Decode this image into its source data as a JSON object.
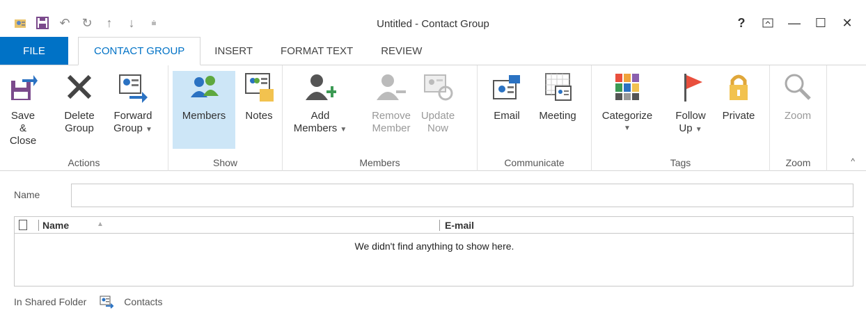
{
  "window": {
    "title": "Untitled - Contact Group",
    "help": "?"
  },
  "tabs": [
    {
      "label": "FILE"
    },
    {
      "label": "CONTACT GROUP"
    },
    {
      "label": "INSERT"
    },
    {
      "label": "FORMAT TEXT"
    },
    {
      "label": "REVIEW"
    }
  ],
  "ribbon": {
    "actions": {
      "label": "Actions",
      "save_close": {
        "line1": "Save &",
        "line2": "Close"
      },
      "delete_group": {
        "line1": "Delete",
        "line2": "Group"
      },
      "forward_group": {
        "line1": "Forward",
        "line2": "Group"
      }
    },
    "show": {
      "label": "Show",
      "members": {
        "line1": "Members"
      },
      "notes": {
        "line1": "Notes"
      }
    },
    "members": {
      "label": "Members",
      "add_members": {
        "line1": "Add",
        "line2": "Members"
      },
      "remove_member": {
        "line1": "Remove",
        "line2": "Member"
      },
      "update_now": {
        "line1": "Update",
        "line2": "Now"
      }
    },
    "communicate": {
      "label": "Communicate",
      "email": {
        "line1": "Email"
      },
      "meeting": {
        "line1": "Meeting"
      }
    },
    "tags": {
      "label": "Tags",
      "categorize": {
        "line1": "Categorize"
      },
      "follow_up": {
        "line1": "Follow",
        "line2": "Up"
      },
      "private": {
        "line1": "Private"
      }
    },
    "zoom": {
      "label": "Zoom",
      "zoom_btn": {
        "line1": "Zoom"
      }
    }
  },
  "form": {
    "name_label": "Name",
    "name_value": ""
  },
  "list": {
    "columns": [
      "Name",
      "E-mail"
    ],
    "empty_message": "We didn't find anything to show here."
  },
  "footer": {
    "label": "In Shared Folder",
    "folder": "Contacts"
  },
  "colors": {
    "accent": "#0072c6",
    "selected": "#cde6f7"
  }
}
